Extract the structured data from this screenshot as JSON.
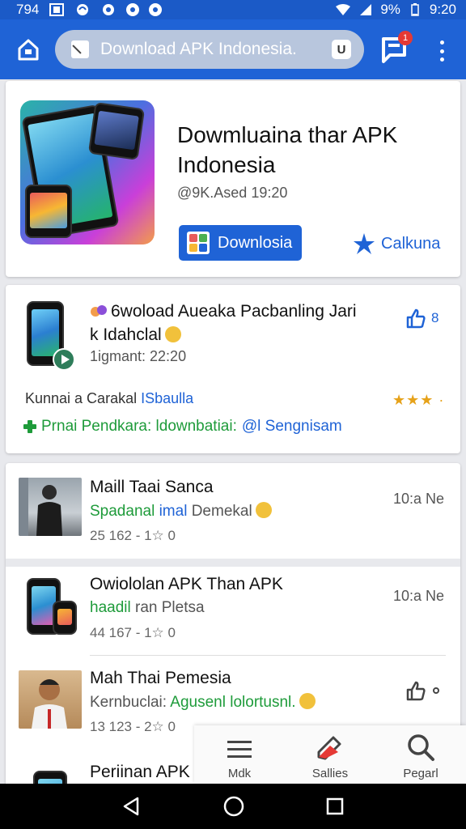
{
  "status_bar": {
    "time_left": "794",
    "battery": "9%",
    "clock": "9:20"
  },
  "toolbar": {
    "url": "Download APK Indonesia.",
    "tab_count": "U",
    "badge": "1"
  },
  "hero": {
    "title": "Dowmluaina thar APK Indonesia",
    "meta": "@9K.Ased 19:20",
    "download_label": "Downlosia",
    "favorite_label": "Calkuna"
  },
  "featured": {
    "title": "6woload Aueaka Pacbanling Jari k Idahclal",
    "meta": "1igmant: 22:20",
    "like_count": "8",
    "category_prefix": "Kunnai a Carakal ",
    "category_link": "ISbaulla",
    "stars": "★★★ ·",
    "promo_green": "Prnai Pendkara: ldownbatiai:",
    "promo_blue": "@l Sengnisam"
  },
  "list": {
    "rows": [
      {
        "title": "Maill Taai Sanca",
        "sub_green": "Spadanal",
        "sub_blue": "imal",
        "sub_rest": "Demekal",
        "stats": "25 162 - 1☆  0",
        "time": "10:a Ne"
      },
      {
        "title": "Owiololan APK Than APK",
        "sub_green": "haadil",
        "sub_rest": "ran Pletsa",
        "stats": "44 167 - 1☆  0",
        "time": "10:a Ne"
      },
      {
        "title": "Mah Thai Pemesia",
        "sub_rest": "Kernbuclai:",
        "sub_green": "Agusenl lolortusnl.",
        "stats": "13 123 - 2☆  0",
        "time": ""
      },
      {
        "title": "Periinan APK I",
        "stats": "",
        "time": ""
      }
    ]
  },
  "bottom_nav": {
    "items": [
      {
        "label": "Mdk",
        "icon": "menu-icon"
      },
      {
        "label": "Sallies",
        "icon": "edit-icon"
      },
      {
        "label": "Pegarl",
        "icon": "search-icon"
      }
    ]
  },
  "colors": {
    "primary": "#1f63d6",
    "status_bar": "#1b5ac7",
    "green": "#1e9b3a",
    "star": "#e6a21a"
  }
}
